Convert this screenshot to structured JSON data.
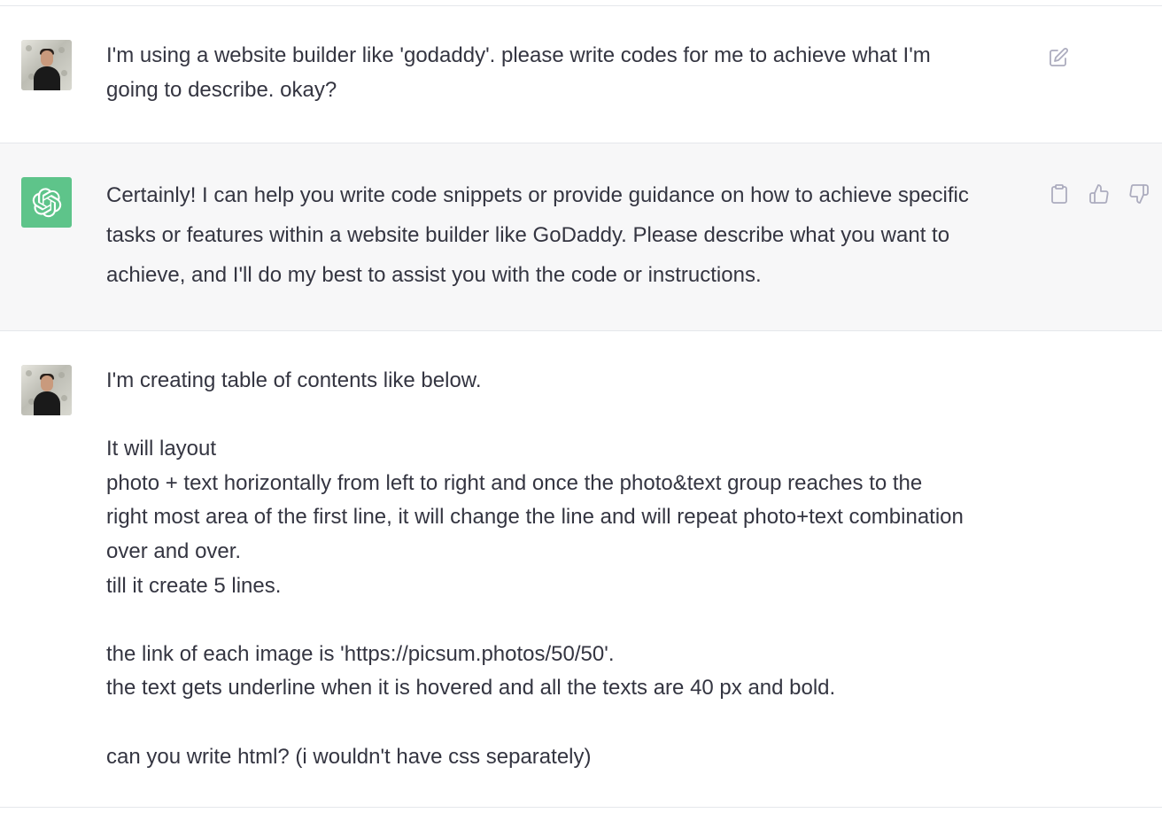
{
  "conversation": {
    "messages": [
      {
        "role": "user",
        "avatar_icon": "user-avatar",
        "lines": [
          "I'm using a website builder like 'godaddy'. please write codes for me to achieve what I'm",
          "going to describe. okay?"
        ],
        "actions": [
          "edit-icon"
        ]
      },
      {
        "role": "assistant",
        "avatar_icon": "openai-logo-icon",
        "lines": [
          "Certainly! I can help you write code snippets or provide guidance on how to achieve specific",
          "tasks or features within a website builder like GoDaddy. Please describe what you want to",
          "achieve, and I'll do my best to assist you with the code or instructions."
        ],
        "actions": [
          "copy-icon",
          "thumbs-up-icon",
          "thumbs-down-icon"
        ]
      },
      {
        "role": "user",
        "avatar_icon": "user-avatar",
        "lines": [
          "I'm creating table of contents like below.",
          "",
          "It will layout",
          "photo + text horizontally from left to right and once the photo&text group reaches to the",
          "right most area of the first line, it will change the line and will repeat photo+text combination",
          "over and over.",
          "till it create 5 lines.",
          "",
          "the link of each image is 'https://picsum.photos/50/50'.",
          "the text gets underline when it is hovered and all the texts are 40 px and bold.",
          "",
          "can you write html? (i wouldn't have css separately)"
        ]
      }
    ]
  },
  "colors": {
    "assistant_bg": "#f7f7f8",
    "assistant_avatar": "#5ec48a",
    "text": "#343541",
    "icon": "#acacbe",
    "divider": "#e5e7eb"
  }
}
